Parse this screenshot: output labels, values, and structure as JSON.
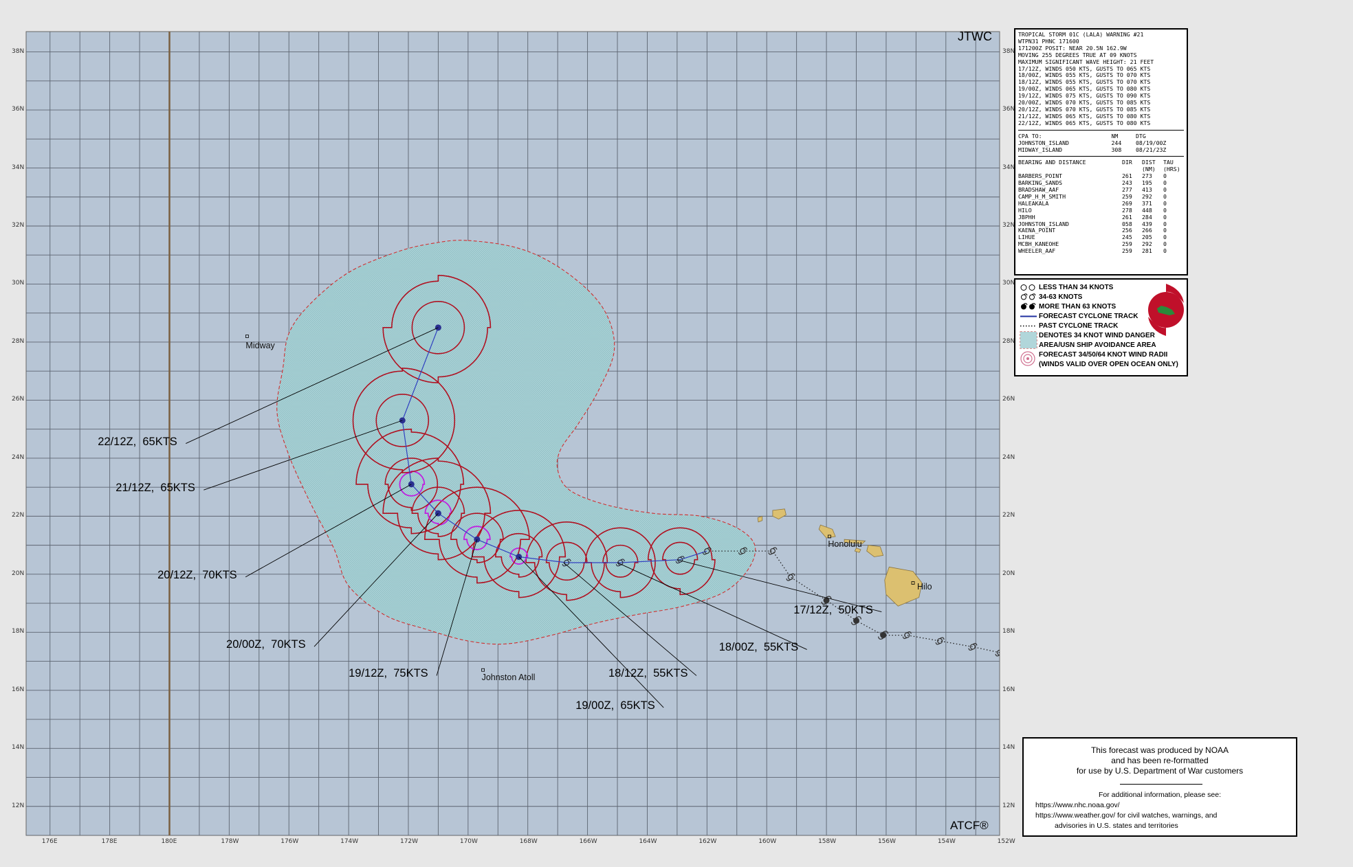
{
  "agency": "JTWC",
  "footer_mark": "ATCF®",
  "axes": {
    "lon_ticks": [
      "176E",
      "178E",
      "180E",
      "178W",
      "176W",
      "174W",
      "172W",
      "170W",
      "168W",
      "166W",
      "164W",
      "162W",
      "160W",
      "158W",
      "156W",
      "154W",
      "152W"
    ],
    "lat_ticks": [
      "38N",
      "36N",
      "34N",
      "32N",
      "30N",
      "28N",
      "26N",
      "24N",
      "22N",
      "20N",
      "18N",
      "16N",
      "14N",
      "12N"
    ],
    "lon_range": [
      175.2,
      207.8
    ],
    "lat_range": [
      11.0,
      38.7
    ]
  },
  "places": [
    {
      "name": "Midway",
      "lat": 28.2,
      "lon": 182.6
    },
    {
      "name": "Johnston Atoll",
      "lat": 16.7,
      "lon": 190.5
    },
    {
      "name": "Honolulu",
      "lat": 21.3,
      "lon": 202.1
    },
    {
      "name": "Hilo",
      "lat": 19.7,
      "lon": 204.9
    }
  ],
  "forecast_labels": [
    {
      "text": "22/12Z,  65KTS",
      "lat": 28.5,
      "lon": 189.0,
      "label_lat": 24.6,
      "label_lon": 177.6
    },
    {
      "text": "21/12Z,  65KTS",
      "lat": 25.3,
      "lon": 187.8,
      "label_lat": 23.0,
      "label_lon": 178.2
    },
    {
      "text": "20/12Z,  70KTS",
      "lat": 23.1,
      "lon": 188.1,
      "label_lat": 20.0,
      "label_lon": 179.6
    },
    {
      "text": "20/00Z,  70KTS",
      "lat": 22.1,
      "lon": 189.0,
      "label_lat": 17.6,
      "label_lon": 181.9
    },
    {
      "text": "19/12Z,  75KTS",
      "lat": 21.2,
      "lon": 190.3,
      "label_lat": 16.6,
      "label_lon": 186.0
    },
    {
      "text": "19/00Z,  65KTS",
      "lat": 20.6,
      "lon": 191.7,
      "label_lat": 15.5,
      "label_lon": 193.6
    },
    {
      "text": "18/12Z,  55KTS",
      "lat": 20.4,
      "lon": 193.2,
      "label_lat": 16.6,
      "label_lon": 194.7
    },
    {
      "text": "18/00Z,  55KTS",
      "lat": 20.4,
      "lon": 195.0,
      "label_lat": 17.5,
      "label_lon": 198.4
    },
    {
      "text": "17/12Z,  50KTS",
      "lat": 20.5,
      "lon": 197.0,
      "label_lat": 18.8,
      "label_lon": 200.9
    }
  ],
  "forecast_track": [
    {
      "lat": 20.8,
      "lon": 198.0,
      "intensity": "34-63"
    },
    {
      "lat": 20.5,
      "lon": 197.1,
      "intensity": "34-63"
    },
    {
      "lat": 20.4,
      "lon": 195.1,
      "intensity": "34-63"
    },
    {
      "lat": 20.4,
      "lon": 193.3,
      "intensity": "34-63"
    },
    {
      "lat": 20.6,
      "lon": 191.7,
      "intensity": "gt63"
    },
    {
      "lat": 21.2,
      "lon": 190.3,
      "intensity": "gt63"
    },
    {
      "lat": 22.1,
      "lon": 189.0,
      "intensity": "gt63"
    },
    {
      "lat": 23.1,
      "lon": 188.1,
      "intensity": "gt63"
    },
    {
      "lat": 25.3,
      "lon": 187.8,
      "intensity": "gt63"
    },
    {
      "lat": 28.5,
      "lon": 189.0,
      "intensity": "gt63"
    }
  ],
  "past_track": [
    {
      "lat": 17.3,
      "lon": 207.8,
      "intensity": "34-63"
    },
    {
      "lat": 17.5,
      "lon": 206.9,
      "intensity": "34-63"
    },
    {
      "lat": 17.7,
      "lon": 205.8,
      "intensity": "34-63"
    },
    {
      "lat": 17.9,
      "lon": 204.7,
      "intensity": "34-63"
    },
    {
      "lat": 17.9,
      "lon": 203.9,
      "intensity": "gt63"
    },
    {
      "lat": 18.4,
      "lon": 203.0,
      "intensity": "gt63"
    },
    {
      "lat": 19.1,
      "lon": 202.0,
      "intensity": "gt63"
    },
    {
      "lat": 19.9,
      "lon": 200.8,
      "intensity": "34-63"
    },
    {
      "lat": 20.8,
      "lon": 200.2,
      "intensity": "34-63"
    },
    {
      "lat": 20.8,
      "lon": 199.2,
      "intensity": "34-63"
    },
    {
      "lat": 20.8,
      "lon": 198.0,
      "intensity": "34-63"
    }
  ],
  "warning_text": {
    "header": [
      "TROPICAL STORM 01C (LALA) WARNING #21",
      "WTPN31 PHNC 171600",
      "171200Z POSIT: NEAR 20.5N 162.9W",
      "MOVING 255 DEGREES TRUE AT 09 KNOTS",
      "MAXIMUM SIGNIFICANT WAVE HEIGHT: 21 FEET",
      "17/12Z, WINDS 050 KTS, GUSTS TO 065 KTS",
      "18/00Z, WINDS 055 KTS, GUSTS TO 070 KTS",
      "18/12Z, WINDS 055 KTS, GUSTS TO 070 KTS",
      "19/00Z, WINDS 065 KTS, GUSTS TO 080 KTS",
      "19/12Z, WINDS 075 KTS, GUSTS TO 090 KTS",
      "20/00Z, WINDS 070 KTS, GUSTS TO 085 KTS",
      "20/12Z, WINDS 070 KTS, GUSTS TO 085 KTS",
      "21/12Z, WINDS 065 KTS, GUSTS TO 080 KTS",
      "22/12Z, WINDS 065 KTS, GUSTS TO 080 KTS"
    ],
    "cpa_header": {
      "c1": "CPA TO:",
      "c2": "NM",
      "c3": "DTG"
    },
    "cpa": [
      {
        "name": "JOHNSTON_ISLAND",
        "nm": "244",
        "dtg": "08/19/00Z"
      },
      {
        "name": "MIDWAY_ISLAND",
        "nm": "308",
        "dtg": "08/21/23Z"
      }
    ],
    "bd_header": {
      "c1": "BEARING AND DISTANCE",
      "c2": "DIR",
      "c3": "DIST",
      "c4": "TAU",
      "c3b": "(NM)",
      "c4b": "(HRS)"
    },
    "bearing_distance": [
      {
        "name": "BARBERS_POINT",
        "dir": "261",
        "dist": "273",
        "tau": "0"
      },
      {
        "name": "BARKING_SANDS",
        "dir": "243",
        "dist": "195",
        "tau": "0"
      },
      {
        "name": "BRADSHAW_AAF",
        "dir": "277",
        "dist": "413",
        "tau": "0"
      },
      {
        "name": "CAMP_H_M_SMITH",
        "dir": "259",
        "dist": "292",
        "tau": "0"
      },
      {
        "name": "HALEAKALA",
        "dir": "269",
        "dist": "371",
        "tau": "0"
      },
      {
        "name": "HILO",
        "dir": "278",
        "dist": "448",
        "tau": "0"
      },
      {
        "name": "JBPHH",
        "dir": "261",
        "dist": "284",
        "tau": "0"
      },
      {
        "name": "JOHNSTON_ISLAND",
        "dir": "058",
        "dist": "439",
        "tau": "0"
      },
      {
        "name": "KAENA_POINT",
        "dir": "256",
        "dist": "266",
        "tau": "0"
      },
      {
        "name": "LIHUE",
        "dir": "245",
        "dist": "205",
        "tau": "0"
      },
      {
        "name": "MCBH_KANEOHE",
        "dir": "259",
        "dist": "292",
        "tau": "0"
      },
      {
        "name": "WHEELER_AAF",
        "dir": "259",
        "dist": "281",
        "tau": "0"
      }
    ]
  },
  "legend": [
    {
      "label": "LESS THAN 34 KNOTS",
      "icon": "open-cyclone-icon"
    },
    {
      "label": "34-63 KNOTS",
      "icon": "half-cyclone-icon"
    },
    {
      "label": "MORE THAN 63 KNOTS",
      "icon": "filled-cyclone-icon"
    },
    {
      "label": "FORECAST CYCLONE TRACK",
      "icon": "solid-line-icon"
    },
    {
      "label": "PAST CYCLONE TRACK",
      "icon": "dotted-line-icon"
    },
    {
      "label": "DENOTES 34 KNOT WIND DANGER",
      "icon": "danger-area-icon"
    },
    {
      "label": "AREA/USN SHIP AVOIDANCE AREA",
      "icon": ""
    },
    {
      "label": "FORECAST 34/50/64 KNOT WIND RADII",
      "icon": "wind-radii-icon"
    },
    {
      "label": "(WINDS VALID OVER OPEN OCEAN ONLY)",
      "icon": ""
    }
  ],
  "notice": {
    "line1": "This forecast was produced by NOAA",
    "line2": "and has been re-formatted",
    "line3": "for use by U.S. Department of War customers",
    "line4": "For additional information, please see:",
    "line5": "https://www.nhc.noaa.gov/",
    "line6": "https://www.weather.gov/ for civil watches, warnings, and",
    "line7": "advisories in U.S. states and territories"
  },
  "colors": {
    "ocean": "#b7c5d5",
    "grid": "#5c6470",
    "danger_fill": "#a9d2d6",
    "danger_edge": "#d03030",
    "radii_34": "#b01020",
    "radii_64": "#c020e0",
    "track": "#3040c0",
    "land": "#dcc070",
    "dateline": "#7a6040"
  }
}
